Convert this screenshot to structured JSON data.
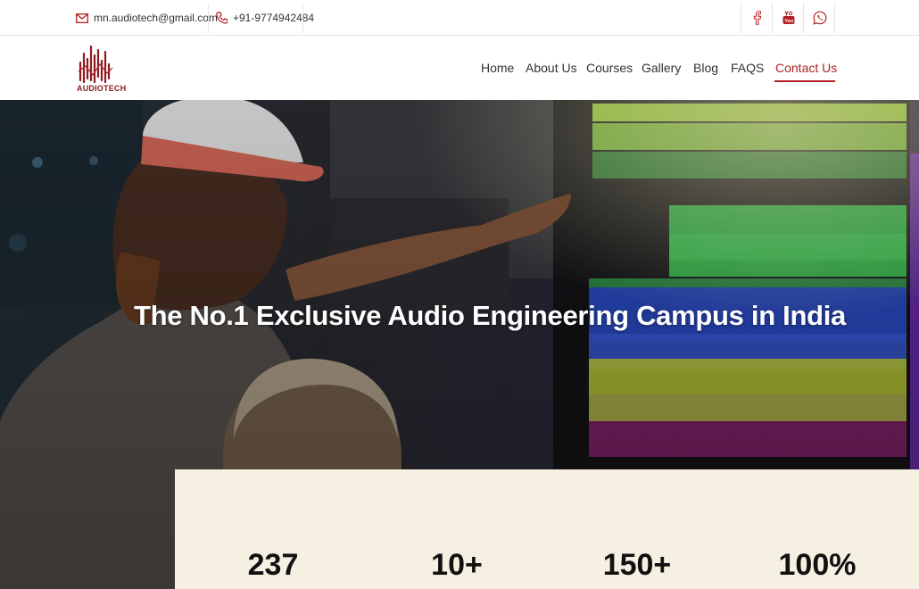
{
  "topbar": {
    "email": "mn.audiotech@gmail.com",
    "phone": "+91-9774942484",
    "social": [
      "facebook-icon",
      "youtube-icon",
      "whatsapp-icon"
    ]
  },
  "brand": {
    "name": "AUDIOTECH",
    "color": "#b32024"
  },
  "nav": {
    "items": [
      {
        "label": "Home"
      },
      {
        "label": "About Us"
      },
      {
        "label": "Courses"
      },
      {
        "label": "Gallery"
      },
      {
        "label": "Blog"
      },
      {
        "label": "FAQS"
      },
      {
        "label": "Contact Us",
        "active": true
      }
    ]
  },
  "hero": {
    "title": "The No.1 Exclusive Audio Engineering Campus in India"
  },
  "stats": [
    {
      "value": "237"
    },
    {
      "value": "10+"
    },
    {
      "value": "150+"
    },
    {
      "value": "100%"
    }
  ],
  "colors": {
    "accent": "#b32024",
    "stats_bg": "#f5f0e1"
  }
}
